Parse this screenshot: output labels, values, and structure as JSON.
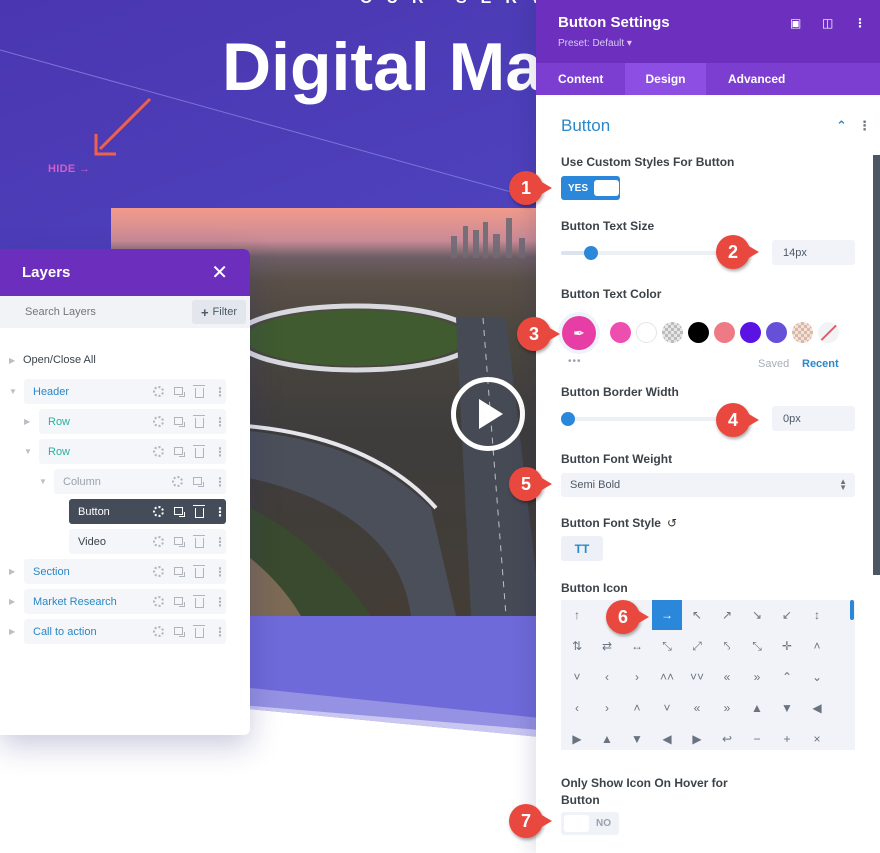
{
  "hero": {
    "kicker": "OUR SERVI",
    "title": "Digital Ma",
    "hide_link": "HIDE →"
  },
  "video": {
    "play_icon": "play-icon"
  },
  "layers": {
    "title": "Layers",
    "close_icon": "✕",
    "search_placeholder": "Search Layers",
    "filter_label": "Filter",
    "filter_icon": "+",
    "open_close_all": "Open/Close All",
    "items": [
      {
        "label": "Header",
        "type": "section",
        "expanded": true
      },
      {
        "label": "Row",
        "type": "row",
        "expanded": false
      },
      {
        "label": "Row",
        "type": "row",
        "expanded": true
      },
      {
        "label": "Column",
        "type": "column",
        "expanded": true
      },
      {
        "label": "Button",
        "type": "module",
        "selected": true
      },
      {
        "label": "Video",
        "type": "module"
      },
      {
        "label": "Section",
        "type": "section",
        "expanded": false
      },
      {
        "label": "Market Research",
        "type": "section",
        "expanded": false
      },
      {
        "label": "Call to action",
        "type": "section",
        "expanded": false
      }
    ]
  },
  "settings": {
    "title": "Button Settings",
    "preset": "Preset: Default ▾",
    "tabs": [
      {
        "label": "Content",
        "active": false
      },
      {
        "label": "Design",
        "active": true
      },
      {
        "label": "Advanced",
        "active": false
      }
    ],
    "section_title": "Button",
    "fields": {
      "custom_styles": {
        "label": "Use Custom Styles For Button",
        "value": "YES",
        "on": true
      },
      "text_size": {
        "label": "Button Text Size",
        "value": "14px",
        "slider_fraction": 0.16
      },
      "text_color": {
        "label": "Button Text Color",
        "current": "#e63ea5",
        "swatches": [
          "#ec4fb0",
          "#ffffff",
          "transparent-gray",
          "#000000",
          "#ee7a86",
          "#5a13e3",
          "#6650d8",
          "transparent-peach",
          "none"
        ],
        "saved_label": "Saved",
        "recent_label": "Recent",
        "more_label": "•••"
      },
      "border_width": {
        "label": "Button Border Width",
        "value": "0px",
        "slider_fraction": 0.0
      },
      "font_weight": {
        "label": "Button Font Weight",
        "value": "Semi Bold"
      },
      "font_style": {
        "label": "Button Font Style",
        "tt_label": "TT",
        "reset_icon": "↺"
      },
      "icon": {
        "label": "Button Icon",
        "selected_index": 3,
        "glyphs": [
          "↑",
          "",
          "",
          "→",
          "↖",
          "↗",
          "↘",
          "↙",
          "↕",
          "⇅",
          "⇄",
          "↔",
          "⤡",
          "⤢",
          "⤣",
          "⤡",
          "✛",
          "˄",
          "˅",
          "‹",
          "›",
          "˄˄",
          "˅˅",
          "«",
          "»",
          "⌃",
          "⌄",
          "‹",
          "›",
          "˄",
          "˅",
          "«",
          "»",
          "▲",
          "▼",
          "◀",
          "▶",
          "▲",
          "▼",
          "◀",
          "▶",
          "↩",
          "−",
          "+",
          "×"
        ]
      },
      "hover_icon": {
        "label": "Only Show Icon On Hover for Button",
        "value": "NO",
        "on": false
      }
    }
  },
  "badges": [
    "1",
    "2",
    "3",
    "4",
    "5",
    "6",
    "7"
  ],
  "colors": {
    "accent_purple": "#6c2fbe",
    "tab_active": "#8c4ee3",
    "primary_blue": "#2b87da",
    "badge_red": "#e9483e",
    "hero_bg": "#4f45c0"
  }
}
